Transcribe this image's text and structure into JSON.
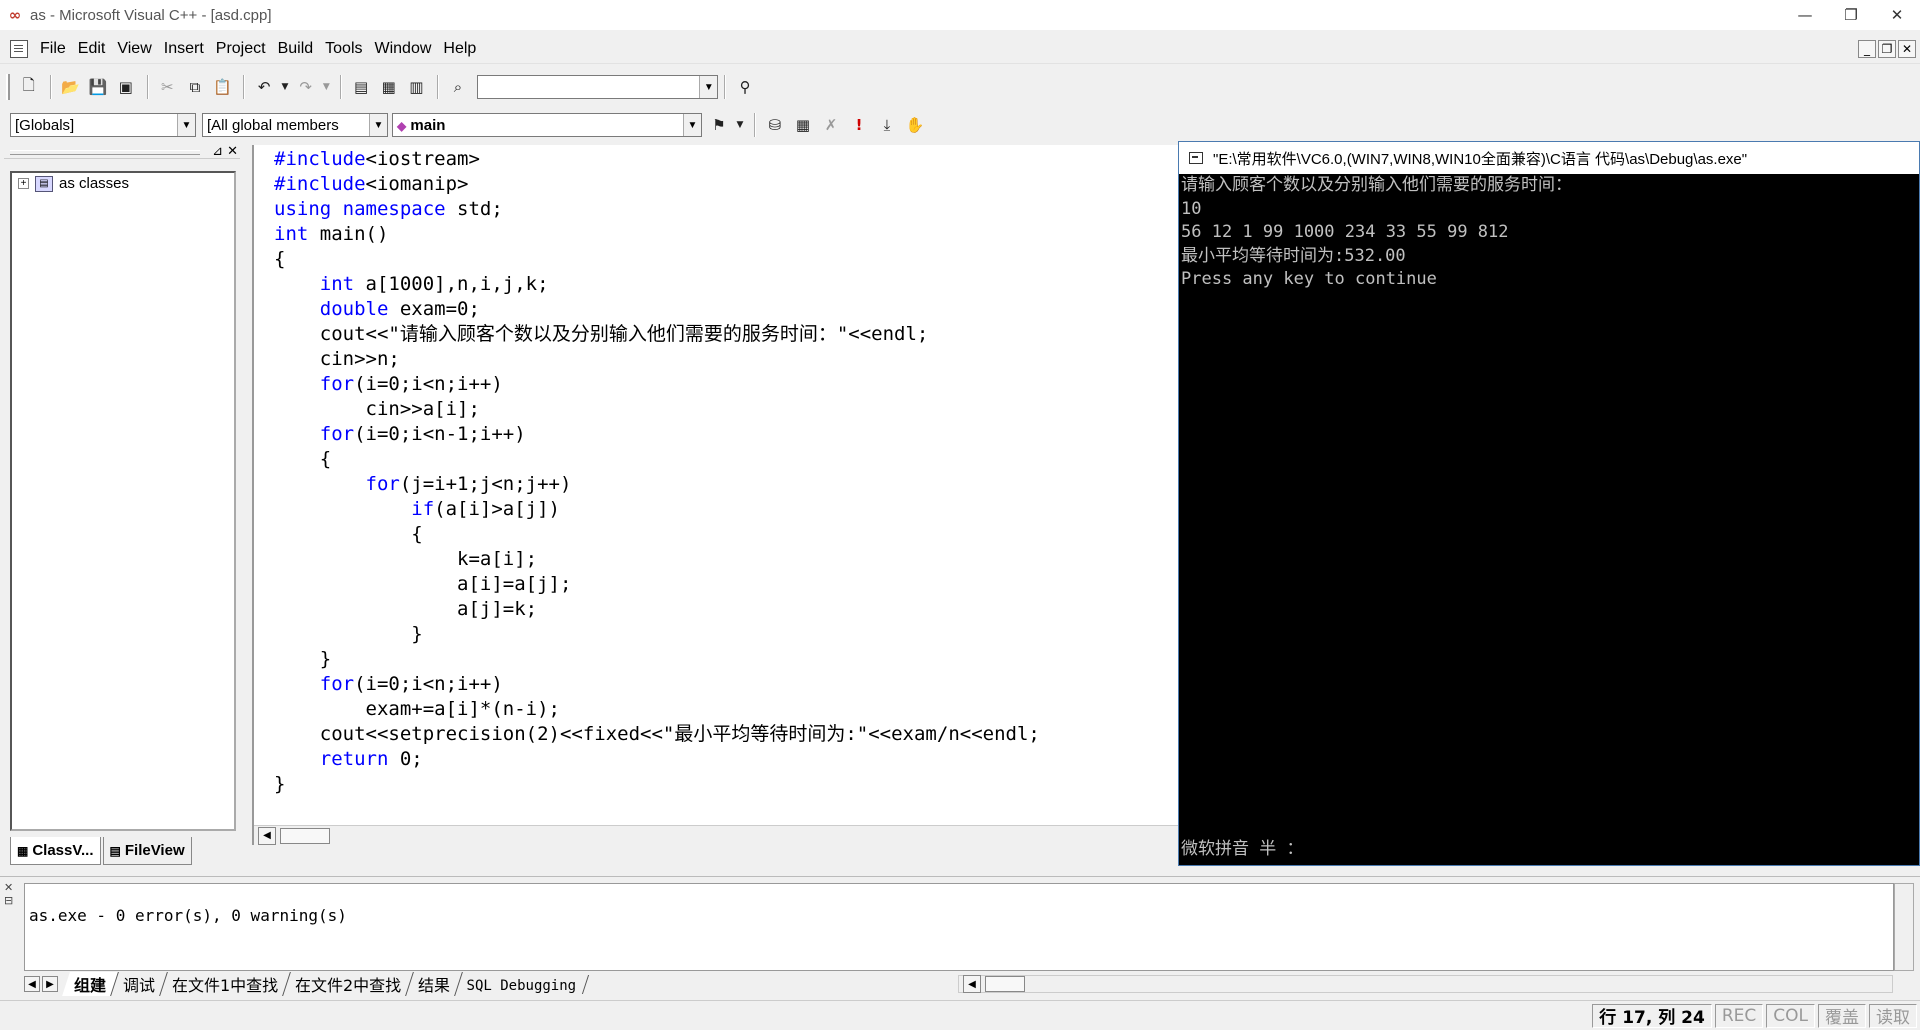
{
  "window": {
    "title": "as - Microsoft Visual C++ - [asd.cpp]"
  },
  "menu": {
    "items": [
      "File",
      "Edit",
      "View",
      "Insert",
      "Project",
      "Build",
      "Tools",
      "Window",
      "Help"
    ]
  },
  "wizardbar": {
    "scope": "[Globals]",
    "members": "[All global members",
    "function": "main"
  },
  "sidebar": {
    "root_label": "as classes",
    "tabs": [
      "ClassV...",
      "FileView"
    ]
  },
  "code": {
    "lines": [
      "#include<iostream>",
      "#include<iomanip>",
      "using namespace std;",
      "int main()",
      "{",
      "    int a[1000],n,i,j,k;",
      "    double exam=0;",
      "    cout<<\"请输入顾客个数以及分别输入他们需要的服务时间：\"<<endl;",
      "    cin>>n;",
      "    for(i=0;i<n;i++)",
      "        cin>>a[i];",
      "    for(i=0;i<n-1;i++)",
      "    {",
      "        for(j=i+1;j<n;j++)",
      "            if(a[i]>a[j])",
      "            {",
      "                k=a[i];",
      "                a[i]=a[j];",
      "                a[j]=k;",
      "            }",
      "    }",
      "    for(i=0;i<n;i++)",
      "        exam+=a[i]*(n-i);",
      "    cout<<setprecision(2)<<fixed<<\"最小平均等待时间为:\"<<exam/n<<endl;",
      "    return 0;",
      "}"
    ]
  },
  "console": {
    "title": "\"E:\\常用软件\\VC6.0,(WIN7,WIN8,WIN10全面兼容)\\C语言 代码\\as\\Debug\\as.exe\"",
    "lines": [
      "请输入顾客个数以及分别输入他们需要的服务时间：",
      "10",
      "56 12 1 99 1000 234 33 55 99 812",
      "最小平均等待时间为:532.00",
      "Press any key to continue"
    ],
    "ime": "微软拼音 半 ："
  },
  "output": {
    "message": "as.exe - 0 error(s), 0 warning(s)",
    "tabs": [
      "组建",
      "调试",
      "在文件1中查找",
      "在文件2中查找",
      "结果",
      "SQL Debugging"
    ]
  },
  "status": {
    "position": "行 17, 列 24",
    "rec": "REC",
    "col": "COL",
    "ovr": "覆盖",
    "read": "读取"
  }
}
